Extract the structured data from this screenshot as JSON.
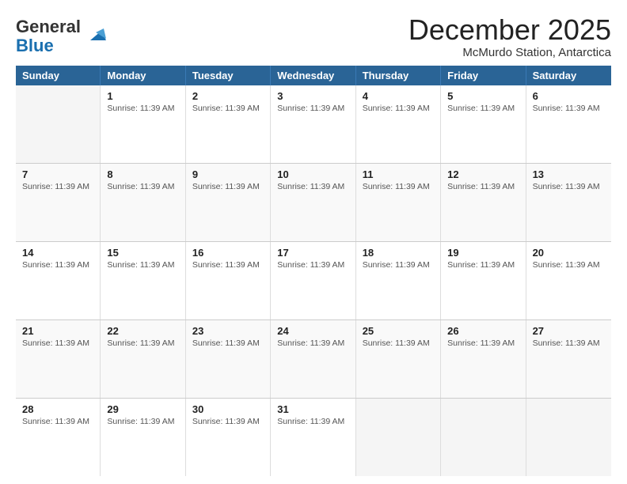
{
  "logo": {
    "line1": "General",
    "line2": "Blue"
  },
  "header": {
    "month": "December 2025",
    "location": "McMurdo Station, Antarctica"
  },
  "days_of_week": [
    "Sunday",
    "Monday",
    "Tuesday",
    "Wednesday",
    "Thursday",
    "Friday",
    "Saturday"
  ],
  "sunrise_time": "Sunrise: 11:39 AM",
  "weeks": [
    [
      {
        "day": "",
        "empty": true
      },
      {
        "day": "1",
        "sunrise": "Sunrise: 11:39 AM"
      },
      {
        "day": "2",
        "sunrise": "Sunrise: 11:39 AM"
      },
      {
        "day": "3",
        "sunrise": "Sunrise: 11:39 AM"
      },
      {
        "day": "4",
        "sunrise": "Sunrise: 11:39 AM"
      },
      {
        "day": "5",
        "sunrise": "Sunrise: 11:39 AM"
      },
      {
        "day": "6",
        "sunrise": "Sunrise: 11:39 AM"
      }
    ],
    [
      {
        "day": "7",
        "sunrise": "Sunrise: 11:39 AM"
      },
      {
        "day": "8",
        "sunrise": "Sunrise: 11:39 AM"
      },
      {
        "day": "9",
        "sunrise": "Sunrise: 11:39 AM"
      },
      {
        "day": "10",
        "sunrise": "Sunrise: 11:39 AM"
      },
      {
        "day": "11",
        "sunrise": "Sunrise: 11:39 AM"
      },
      {
        "day": "12",
        "sunrise": "Sunrise: 11:39 AM"
      },
      {
        "day": "13",
        "sunrise": "Sunrise: 11:39 AM"
      }
    ],
    [
      {
        "day": "14",
        "sunrise": "Sunrise: 11:39 AM"
      },
      {
        "day": "15",
        "sunrise": "Sunrise: 11:39 AM"
      },
      {
        "day": "16",
        "sunrise": "Sunrise: 11:39 AM"
      },
      {
        "day": "17",
        "sunrise": "Sunrise: 11:39 AM"
      },
      {
        "day": "18",
        "sunrise": "Sunrise: 11:39 AM"
      },
      {
        "day": "19",
        "sunrise": "Sunrise: 11:39 AM"
      },
      {
        "day": "20",
        "sunrise": "Sunrise: 11:39 AM"
      }
    ],
    [
      {
        "day": "21",
        "sunrise": "Sunrise: 11:39 AM"
      },
      {
        "day": "22",
        "sunrise": "Sunrise: 11:39 AM"
      },
      {
        "day": "23",
        "sunrise": "Sunrise: 11:39 AM"
      },
      {
        "day": "24",
        "sunrise": "Sunrise: 11:39 AM"
      },
      {
        "day": "25",
        "sunrise": "Sunrise: 11:39 AM"
      },
      {
        "day": "26",
        "sunrise": "Sunrise: 11:39 AM"
      },
      {
        "day": "27",
        "sunrise": "Sunrise: 11:39 AM"
      }
    ],
    [
      {
        "day": "28",
        "sunrise": "Sunrise: 11:39 AM"
      },
      {
        "day": "29",
        "sunrise": "Sunrise: 11:39 AM"
      },
      {
        "day": "30",
        "sunrise": "Sunrise: 11:39 AM"
      },
      {
        "day": "31",
        "sunrise": "Sunrise: 11:39 AM"
      },
      {
        "day": "",
        "empty": true
      },
      {
        "day": "",
        "empty": true
      },
      {
        "day": "",
        "empty": true
      }
    ]
  ]
}
